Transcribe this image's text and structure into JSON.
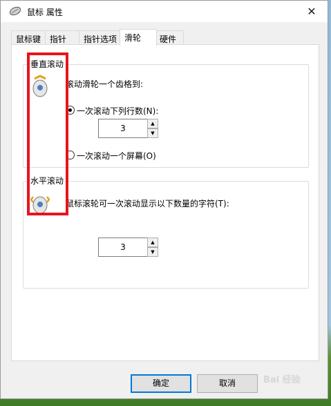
{
  "window": {
    "title": "鼠标 属性",
    "close_glyph": "✕"
  },
  "tabs": [
    "鼠标键",
    "指针",
    "指针选项",
    "滑轮",
    "硬件"
  ],
  "vertical": {
    "legend": "垂直滚动",
    "prompt": "滚动滑轮一个齿格到:",
    "option_lines": "一次滚动下列行数(N):",
    "lines_value": "3",
    "option_screen": "一次滚动一个屏幕(O)"
  },
  "horizontal": {
    "legend": "水平滚动",
    "prompt": "鼠标滚轮可一次滚动显示以下数量的字符(T):",
    "chars_value": "3"
  },
  "spinner": {
    "up": "▲",
    "down": "▼"
  },
  "buttons": {
    "ok": "确定",
    "cancel": "取消"
  },
  "watermark": "Bai 经验",
  "colors": {
    "highlight": "#e8131c",
    "accent": "#0078d7"
  }
}
